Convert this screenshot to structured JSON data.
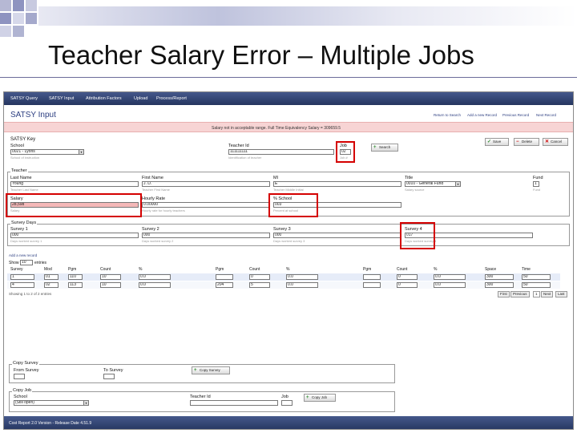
{
  "slide": {
    "title": "Teacher Salary Error – Multiple Jobs"
  },
  "app": {
    "nav_tabs": [
      "SATSY Query",
      "SATSY Input",
      "Attribution Factors",
      "Upload",
      "Process/Report"
    ],
    "page_title": "SATSY Input",
    "top_links": [
      "Return to Search",
      "Add a new Record",
      "Previous Record",
      "Next Record"
    ],
    "error_message": "Salary not in acceptable range. Full Time Equivalency Salary = 309659.5",
    "key": {
      "legend": "SATSY Key",
      "school_label": "School",
      "school_value": "0021 - Lyons",
      "school_hint": "School of instruction",
      "teacher_id_label": "Teacher Id",
      "teacher_id_value": "111111111",
      "teacher_id_hint": "Identification of teacher",
      "job_label": "Job",
      "job_value": "02",
      "job_hint": "Job #",
      "search_button": "Search",
      "save_button": "Save",
      "delete_button": "Delete",
      "cancel_button": "Cancel"
    },
    "teacher": {
      "legend": "Teacher",
      "last_name_label": "Last Name",
      "last_name_value": "Young",
      "last_name_hint": "Teacher Last Name",
      "first_name_label": "First Name",
      "first_name_value": "J. D.",
      "first_name_hint": "Teacher First Name",
      "mi_label": "MI",
      "mi_value": "E",
      "mi_hint": "Teacher Middle Initial",
      "fund_label": "Fund",
      "fund_value": "1",
      "fund_hint": "Fund",
      "salary_label": "Salary",
      "salary_value": "28,598",
      "salary_hint": "Salary",
      "hourly_rate_label": "Hourly Rate",
      "hourly_rate_value": "0.00000",
      "hourly_rate_hint": "Hourly rate for hourly teachers",
      "pct_school_label": "% School",
      "pct_school_value": "003",
      "pct_school_hint": "Percent at school",
      "third_label": "Title",
      "third_value": "0010 - General Fund",
      "third_hint": "Salary source"
    },
    "survey": {
      "legend": "Survey Days",
      "labels": [
        "Survey 1",
        "Survey 2",
        "Survey 3",
        "Survey 4"
      ],
      "values": [
        "000",
        "000",
        "000",
        "017"
      ],
      "hints": [
        "Days worked survey 1",
        "Days worked survey 2",
        "Days worked survey 3",
        "Days worked survey 4"
      ]
    },
    "table": {
      "add_link": "Add a new record",
      "show_label": "Show",
      "show_value": "10",
      "entries_label": "entries",
      "headers": [
        "Survey",
        "Mod",
        "Pgm",
        "Count",
        "%",
        "Pgm",
        "Count",
        "%",
        "Pgm",
        "Count",
        "%",
        "Space",
        "Time"
      ],
      "rows": [
        [
          "1",
          "01",
          "110",
          "10",
          "0.0",
          "",
          "0",
          "0.0",
          "",
          "0",
          "0.0",
          "300",
          "50"
        ],
        [
          "4",
          "02",
          "113",
          "10",
          "0.0",
          "204",
          "5",
          "0.0",
          "",
          "0",
          "0.0",
          "300",
          "50"
        ]
      ],
      "info": "Showing 1 to 2 of 2 entries",
      "pagination": [
        "First",
        "Previous",
        "1",
        "Next",
        "Last"
      ]
    },
    "copy_survey": {
      "legend": "Copy Survey",
      "from_label": "From Survey",
      "to_label": "To Survey",
      "button": "Copy Survey"
    },
    "copy_job": {
      "legend": "Copy Job",
      "school_label": "School",
      "school_value": "(Still open)",
      "teacher_id_label": "Teacher Id",
      "job_label": "Job",
      "button": "Copy Job"
    },
    "footer": "Cost Report 2.0 Version - Release Date 4.51.9"
  },
  "colors": {
    "nav_blue": "#34467a",
    "error_bg": "#f7d4d4",
    "highlight_red": "#d40000",
    "salary_error_bg": "#f4b8b8"
  }
}
